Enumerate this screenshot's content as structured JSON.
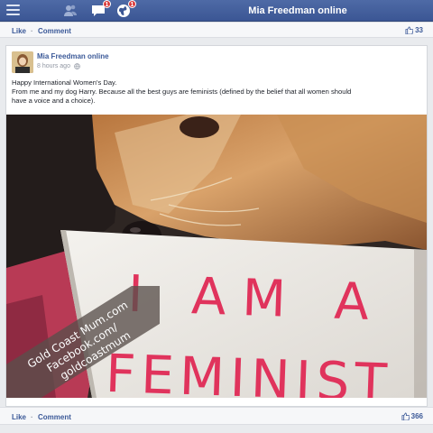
{
  "topbar": {
    "title": "Mia Freedman online",
    "messages_badge": "1",
    "notifications_badge": "1",
    "icons": [
      "menu-icon",
      "friends-icon",
      "messages-icon",
      "notifications-icon"
    ]
  },
  "top_actions": {
    "like": "Like",
    "separator": "·",
    "comment": "Comment",
    "likes_count": "33"
  },
  "post": {
    "author": "Mia Freedman online",
    "time": "8 hours ago",
    "text_lines": [
      "Happy International Women's Day.",
      "From me and my dog Harry. Because all the best guys are feminists (defined by the belief that all women should",
      "have a voice and a choice)."
    ],
    "photo": {
      "sign_line1": "I AM A",
      "sign_line2": "FEMINIST",
      "watermark_lines": [
        "Gold Coast Mum.com",
        "Facebook.com/",
        "goldcoastmum"
      ]
    }
  },
  "bottom_actions": {
    "like": "Like",
    "separator": "·",
    "comment": "Comment",
    "likes_count": "366"
  },
  "colors": {
    "nav": "#3b5694",
    "link": "#3b5998",
    "badge": "#d93b3b",
    "sign_ink": "#e0335c"
  }
}
